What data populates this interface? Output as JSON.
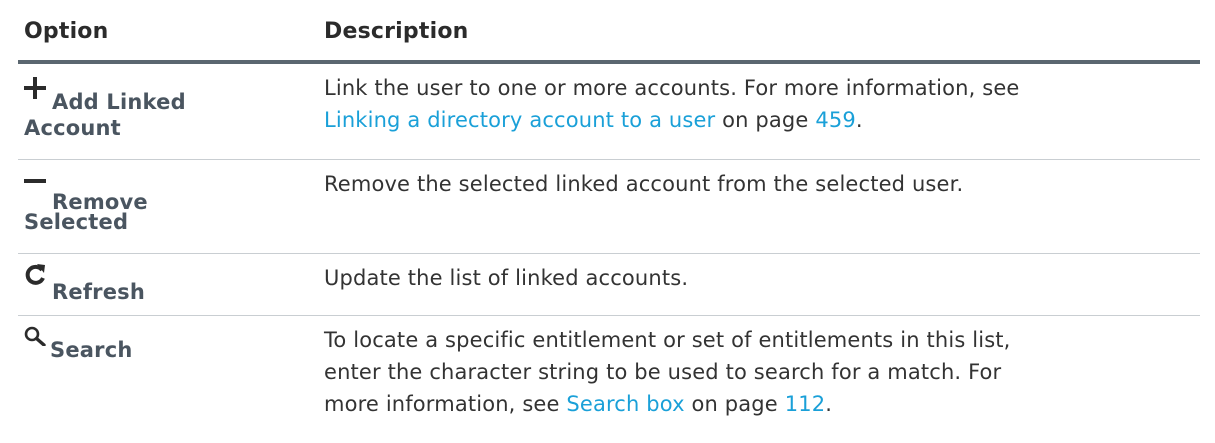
{
  "table": {
    "header": {
      "option": "Option",
      "description": "Description"
    },
    "rows": [
      {
        "icon": "plus-icon",
        "option_line1": "Add Linked",
        "option_line2": "Account",
        "description_text": "Link the user to one or more accounts. For more information, see",
        "link_text": "Linking a directory account to a user",
        "mid_text": "on page",
        "page_number": "459",
        "end_text": "."
      },
      {
        "icon": "minus-icon",
        "option_line1": "Remove",
        "option_line2": "Selected",
        "description_text": "Remove the selected linked account from the selected user."
      },
      {
        "icon": "refresh-icon",
        "option_line1": "Refresh",
        "description_text": "Update the list of linked accounts."
      },
      {
        "icon": "search-icon",
        "option_line1": "Search",
        "description_line1": "To locate a specific entitlement or set of entitlements in this list,",
        "description_line2": "enter the character string to be used to search for a match. For",
        "description_line3_prefix": "more information, see",
        "link_text": "Search box",
        "mid_text": "on page",
        "page_number": "112",
        "end_text": "."
      }
    ]
  },
  "colors": {
    "link": "#1aa0d8",
    "header_rule": "#5b6770",
    "row_rule": "#c9ced2"
  }
}
